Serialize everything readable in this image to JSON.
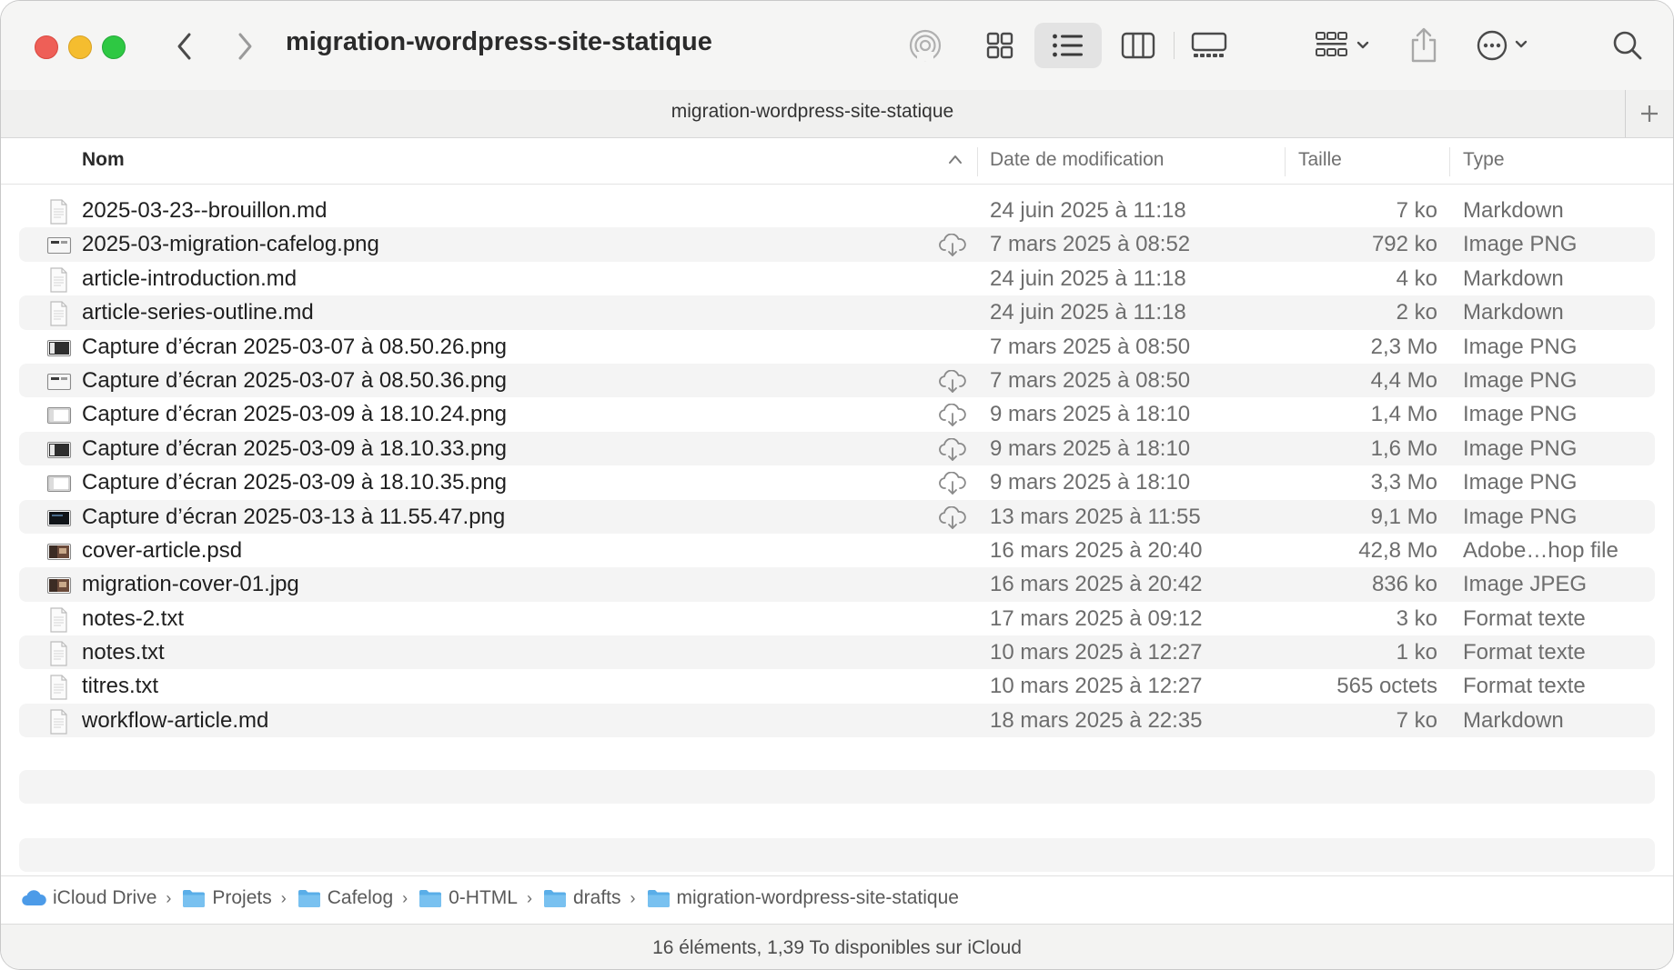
{
  "window": {
    "title": "migration-wordpress-site-statique",
    "tab_label": "migration-wordpress-site-statique"
  },
  "toolbar": {
    "icons": [
      "chevron-left-icon",
      "chevron-right-icon",
      "airdrop-icon",
      "icon-view-icon",
      "list-view-icon",
      "column-view-icon",
      "gallery-view-icon",
      "group-icon",
      "share-icon",
      "more-icon",
      "search-icon"
    ],
    "active_view": "list"
  },
  "columns": {
    "name": "Nom",
    "date": "Date de modification",
    "size": "Taille",
    "type": "Type"
  },
  "files": [
    {
      "name": "2025-03-23--brouillon.md",
      "date": "24 juin 2025 à 11:18",
      "size": "7 ko",
      "type": "Markdown",
      "icon": "doc",
      "cloud": false
    },
    {
      "name": "2025-03-migration-cafelog.png",
      "date": "7 mars 2025 à 08:52",
      "size": "792 ko",
      "type": "Image PNG",
      "icon": "img-light",
      "cloud": true
    },
    {
      "name": "article-introduction.md",
      "date": "24 juin 2025 à 11:18",
      "size": "4 ko",
      "type": "Markdown",
      "icon": "doc",
      "cloud": false
    },
    {
      "name": "article-series-outline.md",
      "date": "24 juin 2025 à 11:18",
      "size": "2 ko",
      "type": "Markdown",
      "icon": "doc",
      "cloud": false
    },
    {
      "name": "Capture d’écran 2025-03-07 à 08.50.26.png",
      "date": "7 mars 2025 à 08:50",
      "size": "2,3 Mo",
      "type": "Image PNG",
      "icon": "img-dark",
      "cloud": false
    },
    {
      "name": "Capture d’écran 2025-03-07 à 08.50.36.png",
      "date": "7 mars 2025 à 08:50",
      "size": "4,4 Mo",
      "type": "Image PNG",
      "icon": "img-light",
      "cloud": true
    },
    {
      "name": "Capture d’écran 2025-03-09 à 18.10.24.png",
      "date": "9 mars 2025 à 18:10",
      "size": "1,4 Mo",
      "type": "Image PNG",
      "icon": "img-white",
      "cloud": true
    },
    {
      "name": "Capture d’écran 2025-03-09 à 18.10.33.png",
      "date": "9 mars 2025 à 18:10",
      "size": "1,6 Mo",
      "type": "Image PNG",
      "icon": "img-dark",
      "cloud": true
    },
    {
      "name": "Capture d’écran 2025-03-09 à 18.10.35.png",
      "date": "9 mars 2025 à 18:10",
      "size": "3,3 Mo",
      "type": "Image PNG",
      "icon": "img-white",
      "cloud": true
    },
    {
      "name": "Capture d’écran 2025-03-13 à 11.55.47.png",
      "date": "13 mars 2025 à 11:55",
      "size": "9,1 Mo",
      "type": "Image PNG",
      "icon": "img-black",
      "cloud": true
    },
    {
      "name": "cover-article.psd",
      "date": "16 mars 2025 à 20:40",
      "size": "42,8 Mo",
      "type": "Adobe…hop file",
      "icon": "photo",
      "cloud": false
    },
    {
      "name": "migration-cover-01.jpg",
      "date": "16 mars 2025 à 20:42",
      "size": "836 ko",
      "type": "Image JPEG",
      "icon": "photo",
      "cloud": false
    },
    {
      "name": "notes-2.txt",
      "date": "17 mars 2025 à 09:12",
      "size": "3 ko",
      "type": "Format texte",
      "icon": "doc",
      "cloud": false
    },
    {
      "name": "notes.txt",
      "date": "10 mars 2025 à 12:27",
      "size": "1 ko",
      "type": "Format texte",
      "icon": "doc",
      "cloud": false
    },
    {
      "name": "titres.txt",
      "date": "10 mars 2025 à 12:27",
      "size": "565 octets",
      "type": "Format texte",
      "icon": "doc",
      "cloud": false
    },
    {
      "name": "workflow-article.md",
      "date": "18 mars 2025 à 22:35",
      "size": "7 ko",
      "type": "Markdown",
      "icon": "doc",
      "cloud": false
    }
  ],
  "path": [
    {
      "label": "iCloud Drive",
      "icon": "icloud-icon"
    },
    {
      "label": "Projets",
      "icon": "folder-icon"
    },
    {
      "label": "Cafelog",
      "icon": "folder-icon"
    },
    {
      "label": "0-HTML",
      "icon": "folder-icon"
    },
    {
      "label": "drafts",
      "icon": "folder-icon"
    },
    {
      "label": "migration-wordpress-site-statique",
      "icon": "folder-icon"
    }
  ],
  "status": "16 éléments, 1,39 To disponibles sur iCloud",
  "colors": {
    "close": "#ee5f57",
    "minimize": "#f5bd2f",
    "maximize": "#2ec843",
    "folder": "#5aaee8",
    "stripe": "#f4f4f4"
  }
}
